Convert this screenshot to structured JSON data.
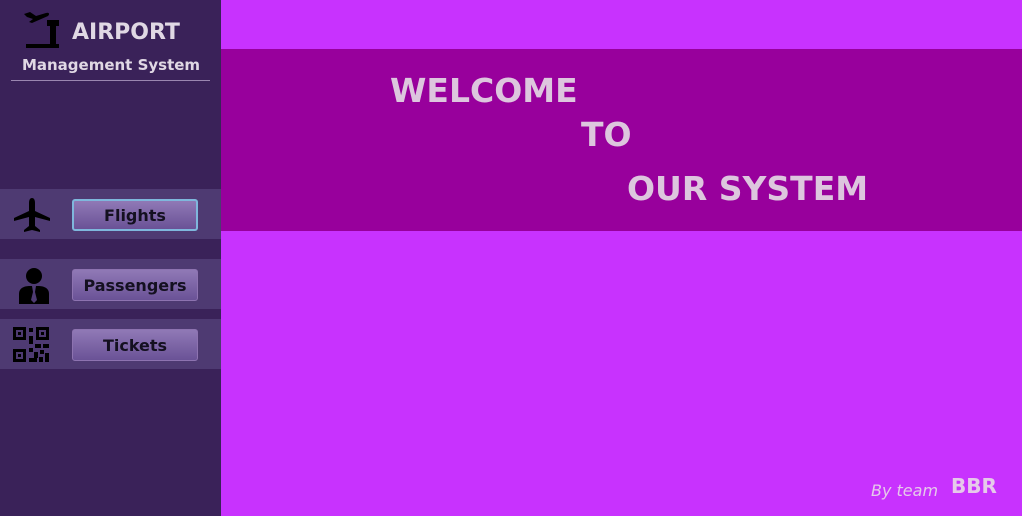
{
  "sidebar": {
    "logo_icon": "airport-departure-icon",
    "title": "AIRPORT",
    "subtitle": "Management System",
    "nav": [
      {
        "icon": "airplane-icon",
        "label": "Flights",
        "active": true
      },
      {
        "icon": "passenger-icon",
        "label": "Passengers",
        "active": false
      },
      {
        "icon": "qr-code-icon",
        "label": "Tickets",
        "active": false
      }
    ]
  },
  "banner": {
    "line1": "WELCOME",
    "line2": "TO",
    "line3": "OUR SYSTEM"
  },
  "footer": {
    "by_label": "By team",
    "team_name": "BBR"
  },
  "colors": {
    "sidebar_bg": "#3a2259",
    "main_bg": "#c832fe",
    "banner_bg": "#98009c",
    "text_light": "#ddc6de"
  }
}
